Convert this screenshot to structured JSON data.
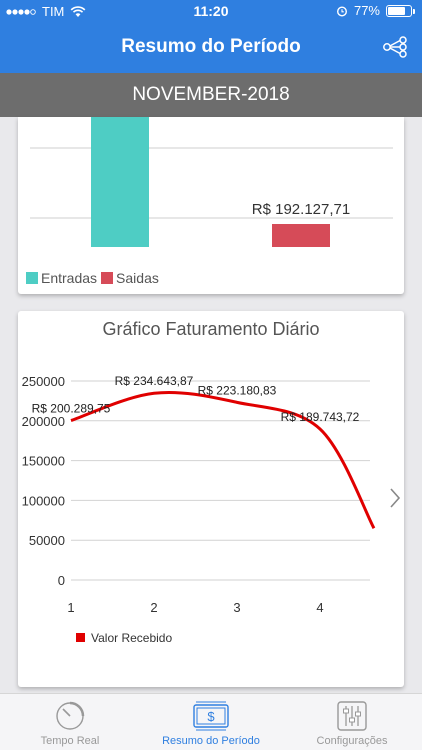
{
  "status": {
    "carrier": "TIM",
    "time": "11:20",
    "battery": "77%",
    "battery_level": 0.77
  },
  "nav": {
    "title": "Resumo do Período"
  },
  "period": "NOVEMBER-2018",
  "colors": {
    "primary": "#2f7fe0",
    "entradas": "#4ecdc4",
    "saidas": "#d64b58",
    "line": "#e00000"
  },
  "chart_data": [
    {
      "type": "bar",
      "categories": [
        "Entradas",
        "Saidas"
      ],
      "series": [
        {
          "name": "Entradas",
          "values": [
            null,
            null
          ]
        },
        {
          "name": "Saidas",
          "values": [
            null,
            192127.71
          ]
        }
      ],
      "data_labels": [
        "",
        "R$ 192.127,71"
      ],
      "legend": [
        "Entradas",
        "Saidas"
      ],
      "legend_position": "bottom-left"
    },
    {
      "type": "line",
      "title": "Gráfico Faturamento Diário",
      "x": [
        1,
        2,
        3,
        4,
        4.65
      ],
      "series": [
        {
          "name": "Valor Recebido",
          "values": [
            200289.75,
            234643.87,
            223180.83,
            189743.72,
            65000
          ]
        }
      ],
      "data_labels": [
        "R$ 200.289,75",
        "R$ 234.643,87",
        "R$ 223.180,83",
        "R$ 189.743,72"
      ],
      "x_ticks": [
        "1",
        "2",
        "3",
        "4"
      ],
      "y_ticks": [
        "250000",
        "200000",
        "150000",
        "100000",
        "50000",
        "0"
      ],
      "ylim": [
        0,
        250000
      ],
      "legend": [
        "Valor Recebido"
      ],
      "legend_position": "bottom-left",
      "grid": true
    }
  ],
  "tabs": [
    {
      "label": "Tempo Real",
      "icon": "gauge-icon"
    },
    {
      "label": "Resumo do Período",
      "icon": "money-icon"
    },
    {
      "label": "Configurações",
      "icon": "sliders-icon"
    }
  ]
}
